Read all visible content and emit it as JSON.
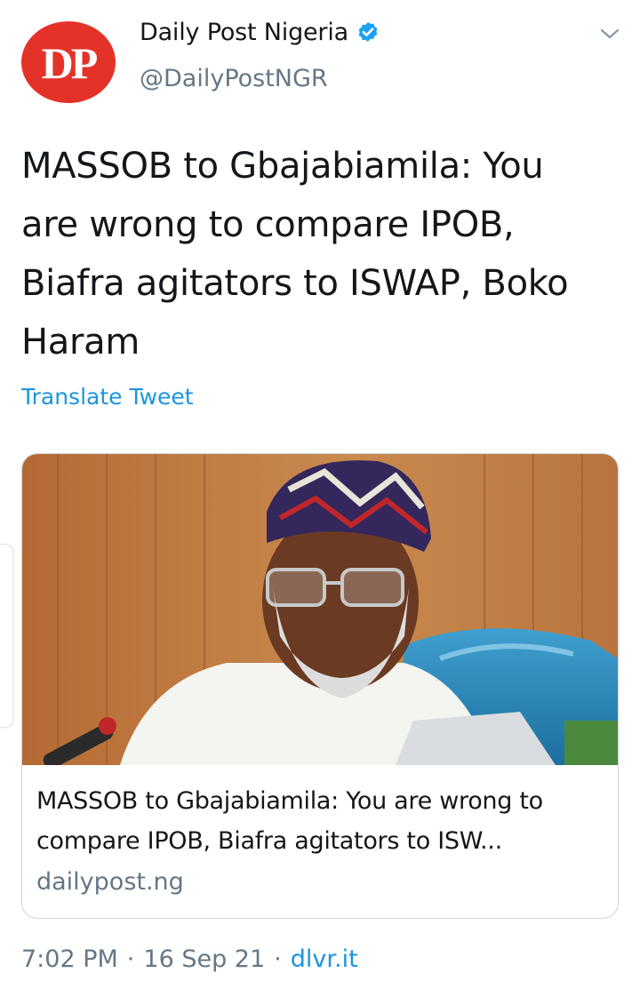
{
  "header": {
    "avatar_initials": "DP",
    "display_name": "Daily Post Nigeria",
    "handle": "@DailyPostNGR",
    "verified": true
  },
  "tweet": {
    "text": "MASSOB to Gbajabiamila: You are wrong to compare IPOB, Biafra agitators to ISWAP, Boko Haram",
    "translate_label": "Translate Tweet"
  },
  "card": {
    "title": "MASSOB to Gbajabiamila: You are wrong to compare IPOB, Biafra agitators to ISW...",
    "domain": "dailypost.ng"
  },
  "meta": {
    "time": "7:02 PM",
    "separator": "·",
    "date": "16 Sep 21",
    "source": "dlvr.it"
  },
  "icons": {
    "verified": "verified-badge-icon",
    "more": "chevron-down-icon"
  },
  "colors": {
    "brand_red": "#e53228",
    "link_blue": "#1b95e0",
    "muted_gray": "#657786",
    "verified_blue": "#1da1f2"
  }
}
